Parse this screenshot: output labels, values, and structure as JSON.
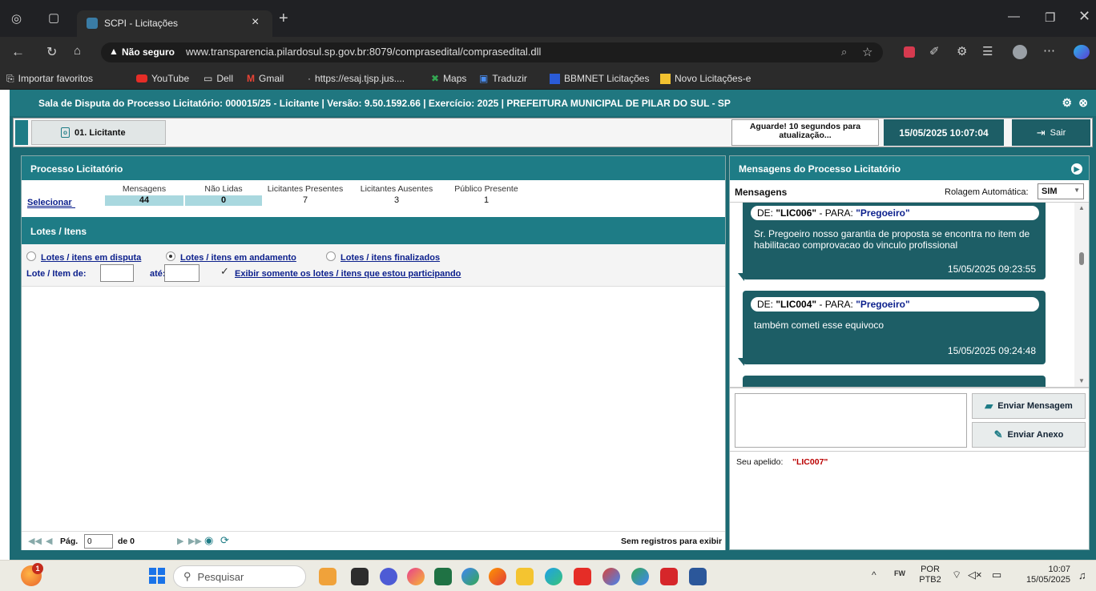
{
  "browser": {
    "tab_title": "SCPI - Licitações",
    "not_secure_label": "Não seguro",
    "url": "www.transparencia.pilardosul.sp.gov.br:8079/comprasedital/comprasedital.dll",
    "favorites": [
      "Importar favoritos",
      "YouTube",
      "Dell",
      "Gmail",
      "https://esaj.tjsp.jus....",
      "Maps",
      "Traduzir",
      "BBMNET Licitações",
      "Novo Licitações-e"
    ]
  },
  "app": {
    "title": "Sala de Disputa do Processo Licitatório: 000015/25 - Licitante | Versão: 9.50.1592.66 | Exercício: 2025 | PREFEITURA MUNICIPAL DE PILAR DO SUL - SP",
    "tab_label": "01. Licitante",
    "refresh_notice": "Aguarde! 10 segundos para atualização...",
    "datetime": "15/05/2025 10:07:04",
    "exit_label": "Sair"
  },
  "process": {
    "header": "Processo Licitatório",
    "select_link": "Selecionar",
    "stats": [
      {
        "label": "Mensagens",
        "value": "44"
      },
      {
        "label": "Não Lidas",
        "value": "0"
      },
      {
        "label": "Licitantes Presentes",
        "value": "7"
      },
      {
        "label": "Licitantes Ausentes",
        "value": "3"
      },
      {
        "label": "Público Presente",
        "value": "1"
      }
    ]
  },
  "lots": {
    "header": "Lotes / Itens",
    "filters": [
      {
        "label": "Lotes / itens em disputa",
        "selected": false
      },
      {
        "label": "Lotes / itens em andamento",
        "selected": true
      },
      {
        "label": "Lotes / itens finalizados",
        "selected": false
      }
    ],
    "range_label": "Lote / Item de:",
    "until_label": "até:",
    "only_mine_label": "Exibir somente os lotes / itens que estou participando",
    "only_mine_checked": true,
    "page_label": "Pág.",
    "page_value": "0",
    "of_label": "de 0",
    "no_records": "Sem registros para exibir"
  },
  "messages": {
    "header": "Mensagens do Processo Licitatório",
    "subheader": "Mensagens",
    "autoscroll_label": "Rolagem Automática:",
    "autoscroll_value": "SIM",
    "items": [
      {
        "de_label": "DE:",
        "from": "\"LIC006\"",
        "para_label": "- PARA:",
        "to": "\"Pregoeiro\"",
        "text": "Sr. Pregoeiro nosso garantia de proposta se encontra no item de habilitacao comprovacao do vinculo profissional",
        "time": "15/05/2025 09:23:55"
      },
      {
        "de_label": "DE:",
        "from": "\"LIC004\"",
        "para_label": "- PARA:",
        "to": "\"Pregoeiro\"",
        "text": "também cometi esse equivoco",
        "time": "15/05/2025 09:24:48"
      }
    ],
    "send_label": "Enviar Mensagem",
    "attach_label": "Enviar Anexo",
    "nickname_label": "Seu apelido:",
    "nickname_value": "\"LIC007\""
  },
  "taskbar": {
    "search_placeholder": "Pesquisar",
    "lang_top": "POR",
    "lang_bottom": "PTB2",
    "time": "10:07",
    "date": "15/05/2025",
    "notification_badge": "1"
  },
  "colors": {
    "teal_header": "#1e7c86",
    "teal_app": "#1c6a73",
    "message_bubble": "#1d5e66",
    "stat_bg": "#a9d8df"
  }
}
